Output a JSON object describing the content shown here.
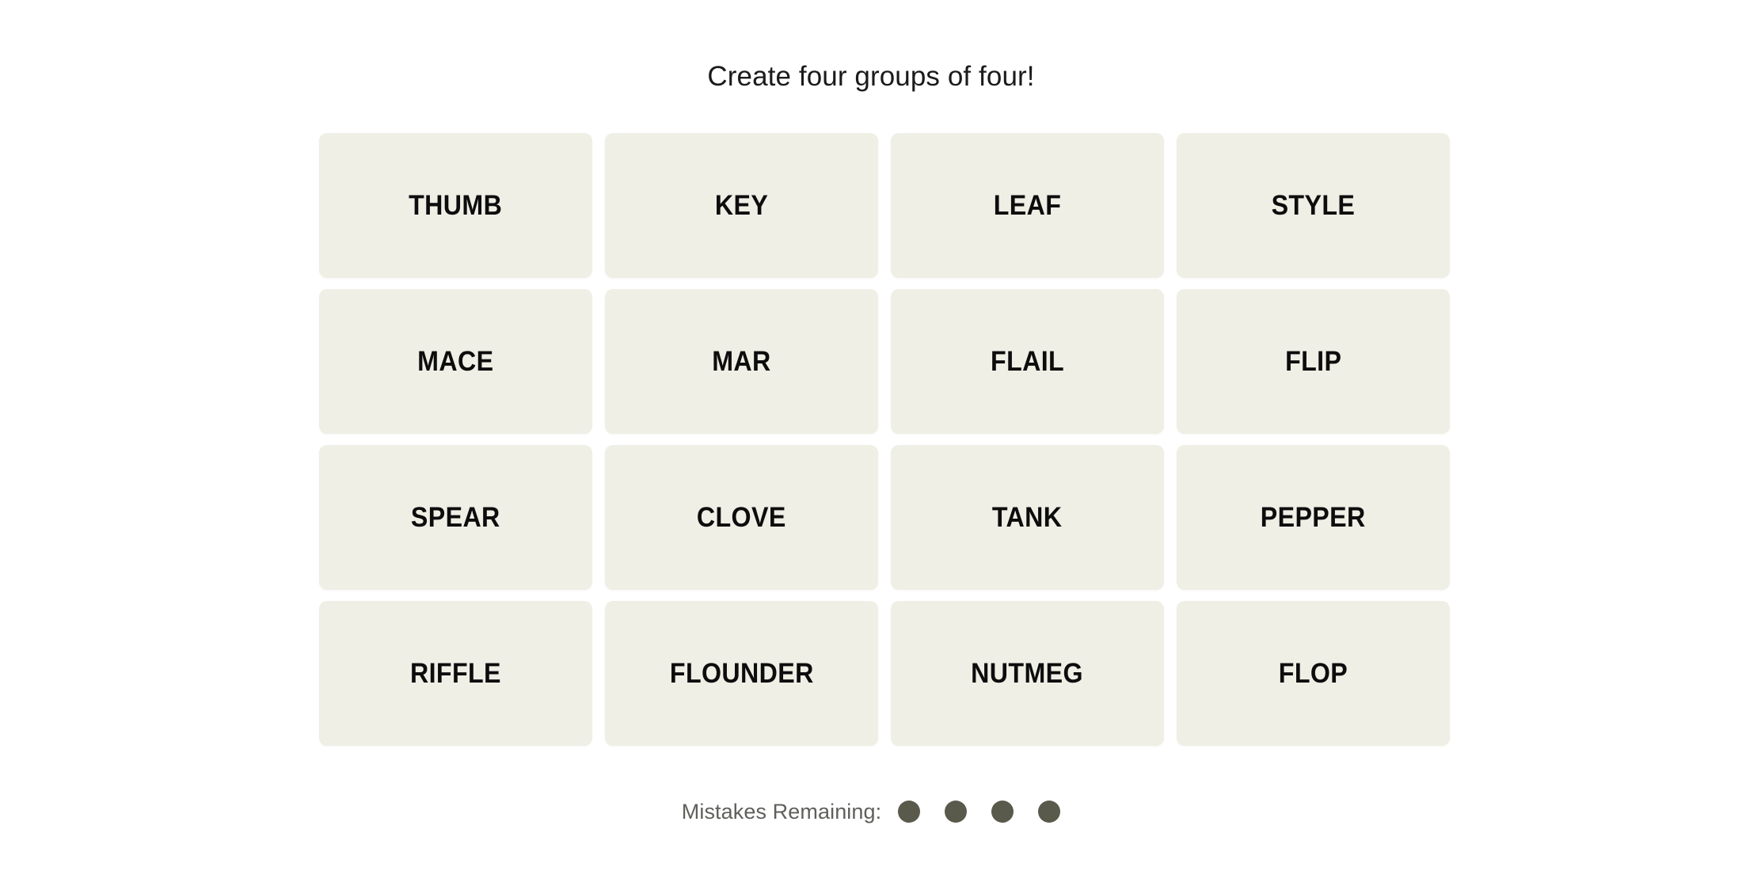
{
  "page": {
    "background_color": "#ffffff"
  },
  "header": {
    "instruction": "Create four groups of four!"
  },
  "board": {
    "rows": 4,
    "columns": 4,
    "tile_color": "#efefe6",
    "tile_text_color": "#0d0d0d",
    "tiles": [
      {
        "label": "THUMB",
        "selected": false
      },
      {
        "label": "KEY",
        "selected": false
      },
      {
        "label": "LEAF",
        "selected": false
      },
      {
        "label": "STYLE",
        "selected": false
      },
      {
        "label": "MACE",
        "selected": false
      },
      {
        "label": "MAR",
        "selected": false
      },
      {
        "label": "FLAIL",
        "selected": false
      },
      {
        "label": "FLIP",
        "selected": false
      },
      {
        "label": "SPEAR",
        "selected": false
      },
      {
        "label": "CLOVE",
        "selected": false
      },
      {
        "label": "TANK",
        "selected": false
      },
      {
        "label": "PEPPER",
        "selected": false
      },
      {
        "label": "RIFFLE",
        "selected": false
      },
      {
        "label": "FLOUNDER",
        "selected": false
      },
      {
        "label": "NUTMEG",
        "selected": false
      },
      {
        "label": "FLOP",
        "selected": false
      }
    ]
  },
  "mistakes": {
    "label": "Mistakes Remaining:",
    "label_color": "#5f5f5b",
    "remaining": 4,
    "dot_color": "#5a5a4c",
    "dots": [
      {
        "filled": true
      },
      {
        "filled": true
      },
      {
        "filled": true
      },
      {
        "filled": true
      }
    ]
  }
}
